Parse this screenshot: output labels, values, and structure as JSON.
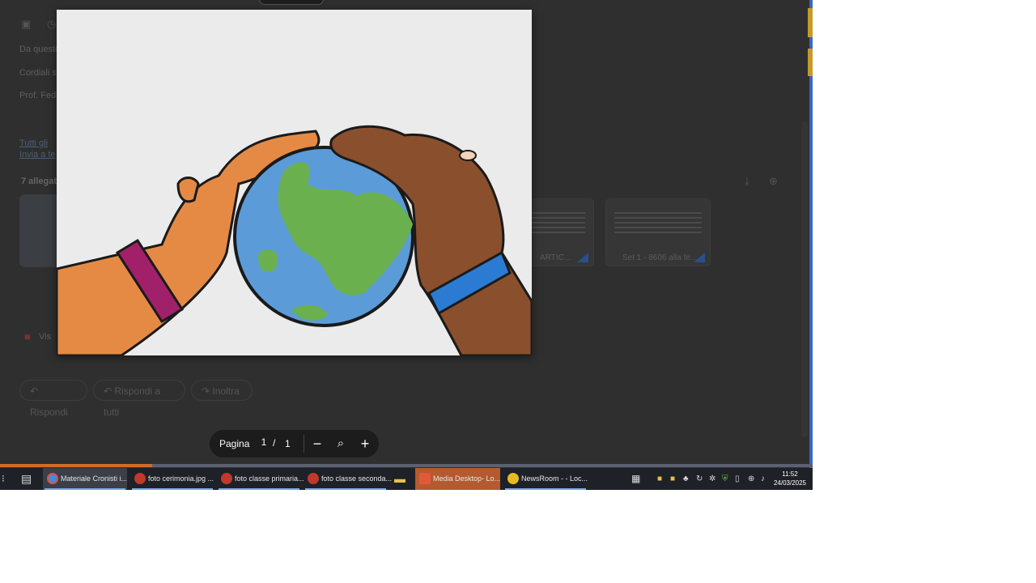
{
  "mail_background": {
    "line1": "Da questo",
    "line2": "Cordiali sa",
    "line3": "Prof. Fede",
    "link1": "Tutti gli",
    "link2": "Invia a te",
    "attachments_header": "7 allegat",
    "attachment_label_1": "ARTIC...",
    "attachment_label_2": "Set 1 - 8606 alla fe...",
    "footer_item": "Vis",
    "reply_label": "Rispondi",
    "reply_all_label": "Rispondi a tutti",
    "forward_label": "Inoltra"
  },
  "viewer": {
    "pager": {
      "label": "Pagina",
      "current_page": "1",
      "separator": "/",
      "total_pages": "1"
    }
  },
  "taskbar": {
    "items": [
      {
        "label": "Materiale Cronisti i...",
        "icon": "chrome-icon",
        "color": "#3b8ee0"
      },
      {
        "label": "foto cerimonia.jpg ...",
        "icon": "photos-icon",
        "color": "#c0392b"
      },
      {
        "label": "foto classe primaria...",
        "icon": "photos-icon",
        "color": "#c0392b"
      },
      {
        "label": "foto classe seconda...",
        "icon": "photos-icon",
        "color": "#c0392b"
      },
      {
        "label": "Media Desktop- Lo...",
        "icon": "media-icon",
        "color": "#b55a2e"
      },
      {
        "label": "NewsRoom - - Loc...",
        "icon": "newsroom-icon",
        "color": "#e8b923"
      }
    ],
    "clock_time": "11:52",
    "clock_date": "24/03/2025"
  },
  "colors": {
    "dim_background": "#2f2f2f",
    "taskbar": "#1e2127",
    "accent_orange": "#d06b2a"
  }
}
